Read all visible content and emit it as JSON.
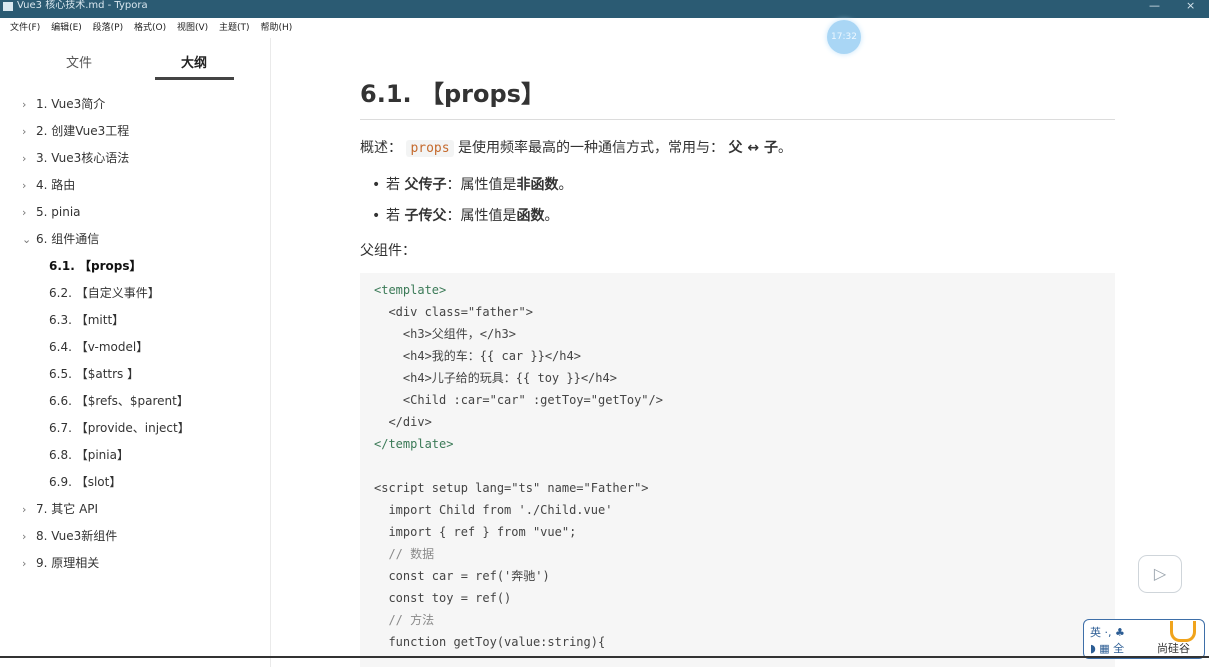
{
  "window": {
    "title": "Vue3 核心技术.md - Typora",
    "minimize_glyph": "—",
    "close_glyph": "×"
  },
  "menu": [
    "文件(F)",
    "编辑(E)",
    "段落(P)",
    "格式(O)",
    "视图(V)",
    "主题(T)",
    "帮助(H)"
  ],
  "badge_time": "17:32",
  "sidebar": {
    "tabs": {
      "files": "文件",
      "outline": "大纲"
    },
    "items": [
      {
        "chev": "›",
        "label": "1. Vue3简介"
      },
      {
        "chev": "›",
        "label": "2. 创建Vue3工程"
      },
      {
        "chev": "›",
        "label": "3. Vue3核心语法"
      },
      {
        "chev": "›",
        "label": "4. 路由"
      },
      {
        "chev": "›",
        "label": "5. pinia"
      },
      {
        "chev": "⌄",
        "label": "6. 组件通信"
      }
    ],
    "subitems": [
      "6.1. 【props】",
      "6.2. 【自定义事件】",
      "6.3. 【mitt】",
      "6.4. 【v-model】",
      "6.5. 【$attrs 】",
      "6.6. 【$refs、$parent】",
      "6.7. 【provide、inject】",
      "6.8. 【pinia】",
      "6.9. 【slot】"
    ],
    "items_after": [
      {
        "chev": "›",
        "label": "7. 其它 API"
      },
      {
        "chev": "›",
        "label": "8. Vue3新组件"
      },
      {
        "chev": "›",
        "label": "9. 原理相关"
      }
    ]
  },
  "doc": {
    "heading": "6.1. 【props】",
    "summary_prefix": "概述：",
    "summary_code": "props",
    "summary_mid": "是使用频率最高的一种通信方式，常用与：",
    "summary_bold": "父 ↔ 子",
    "summary_end": "。",
    "bullets": [
      {
        "prefix": "若 ",
        "bold1": "父传子",
        "mid": "：属性值是",
        "bold2": "非函数",
        "end": "。"
      },
      {
        "prefix": "若 ",
        "bold1": "子传父",
        "mid": "：属性值是",
        "bold2": "函数",
        "end": "。"
      }
    ],
    "parent_label": "父组件：",
    "code": [
      "<template>",
      "  <div class=\"father\">",
      "    <h3>父组件，</h3>",
      "    <h4>我的车：{{ car }}</h4>",
      "    <h4>儿子给的玩具：{{ toy }}</h4>",
      "    <Child :car=\"car\" :getToy=\"getToy\"/>",
      "  </div>",
      "</template>",
      "",
      "<script setup lang=\"ts\" name=\"Father\">",
      "  import Child from './Child.vue'",
      "  import { ref } from \"vue\";",
      "  // 数据",
      "  const car = ref('奔驰')",
      "  const toy = ref()",
      "  // 方法",
      "  function getToy(value:string){"
    ]
  },
  "overlay": {
    "play_icon": "▷",
    "ime_line1": "英 ·, ♣",
    "ime_line2": "◗ ▦ 全",
    "ime_brand": "尚硅谷"
  }
}
